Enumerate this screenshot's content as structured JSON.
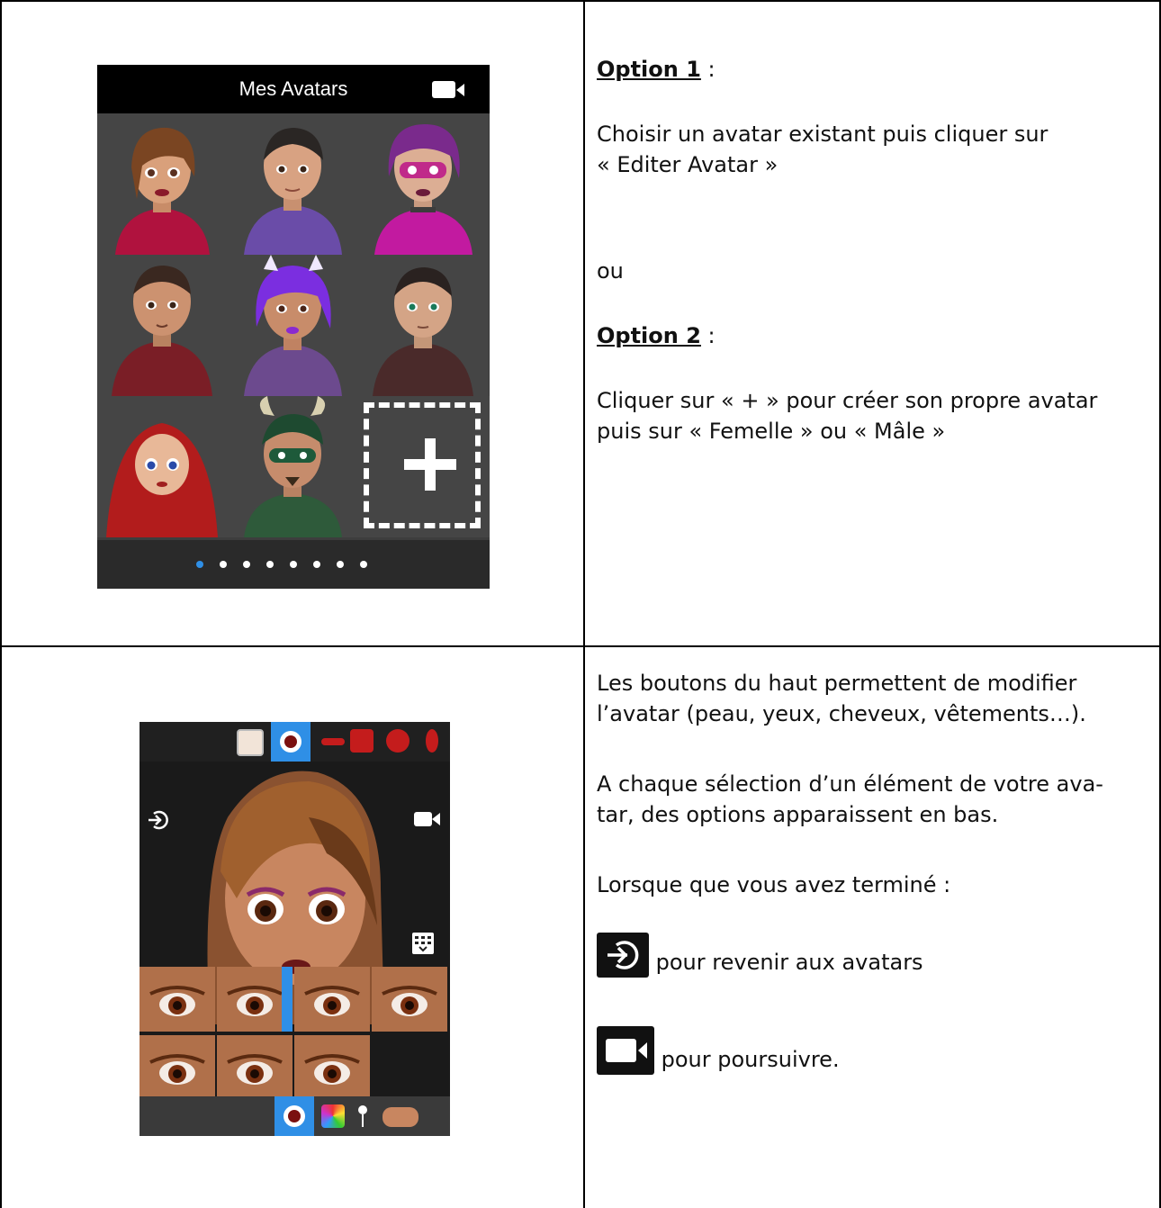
{
  "screenshot1": {
    "title": "Mes Avatars",
    "pager_dots": 8,
    "active_dot": 0
  },
  "instructions1": {
    "option1_label": "Option 1",
    "option1_suffix": " :",
    "option1_text_line1": "Choisir un avatar existant puis cliquer sur",
    "option1_text_line2": "« Editer Avatar »",
    "or_text": "ou",
    "option2_label": "Option 2",
    "option2_suffix": " :",
    "option2_text_line1": "Cliquer sur « + » pour créer son propre avatar",
    "option2_text_line2": "puis sur « Femelle » ou « Mâle »"
  },
  "instructions2": {
    "p1_line1": "Les boutons du haut permettent de modifier",
    "p1_line2": "l’avatar (peau, yeux, cheveux, vêtements…).",
    "p2_line1": "A chaque sélection d’un élément de votre ava-",
    "p2_line2": "tar, des options apparaissent en bas.",
    "p3": "Lorsque que vous avez terminé :",
    "back_text": " pour revenir aux avatars",
    "continue_text": " pour poursuivre."
  },
  "colors": {
    "accent_blue": "#2f8fe6",
    "dark_bg": "#1a1a1a"
  }
}
